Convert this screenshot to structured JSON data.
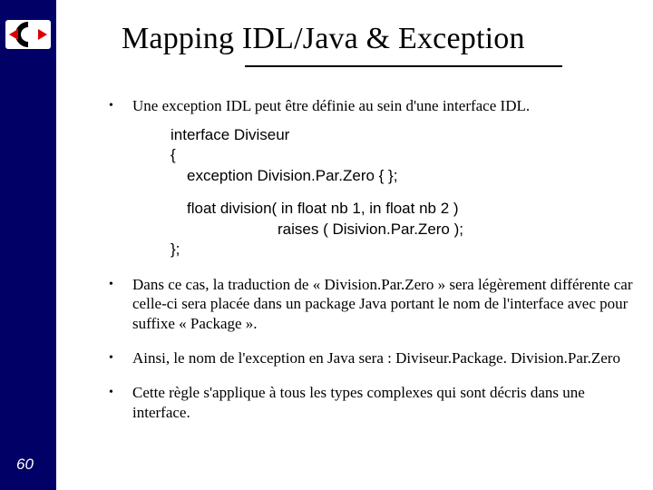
{
  "page_number": "60",
  "title": "Mapping IDL/Java & Exception",
  "bullets": {
    "b1": "Une exception IDL peut être définie au sein d'une interface IDL.",
    "b2": "Dans ce cas, la traduction de « Division.Par.Zero » sera légèrement différente car celle-ci sera placée dans un package Java portant le nom de l'interface avec pour suffixe « Package ».",
    "b3": "Ainsi, le nom de l'exception en Java sera : Diviseur.Package. Division.Par.Zero",
    "b4": "Cette règle s'applique à tous les types complexes qui sont décris dans une interface."
  },
  "code": {
    "l1": "interface Diviseur",
    "l2": "{",
    "l3": "exception Division.Par.Zero { };",
    "l4": "float division( in float nb 1, in float nb 2 )",
    "l5": "raises ( Disivion.Par.Zero );",
    "l6": "};"
  }
}
